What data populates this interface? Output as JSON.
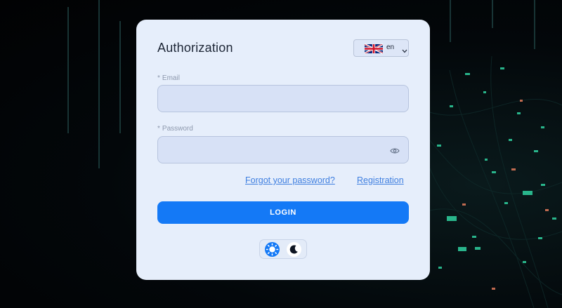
{
  "auth": {
    "title": "Authorization",
    "language": {
      "code": "en",
      "flag_icon": "uk-flag-icon",
      "dropdown_icon": "chevron-down-icon"
    },
    "email": {
      "label": "Email",
      "required_mark": "*",
      "value": "",
      "placeholder": ""
    },
    "password": {
      "label": "Password",
      "required_mark": "*",
      "value": "",
      "placeholder": "",
      "toggle_icon": "eye-icon"
    },
    "links": {
      "forgot": "Forgot your password?",
      "register": "Registration"
    },
    "login_label": "LOGIN",
    "theme_switch": {
      "light_icon": "sun-icon",
      "dark_icon": "moon-icon",
      "selected": "light"
    }
  },
  "colors": {
    "accent": "#1479f6",
    "link": "#3f7fe0",
    "card": "#e6eefb",
    "field": "#d7e1f6",
    "background": "#02050a"
  }
}
